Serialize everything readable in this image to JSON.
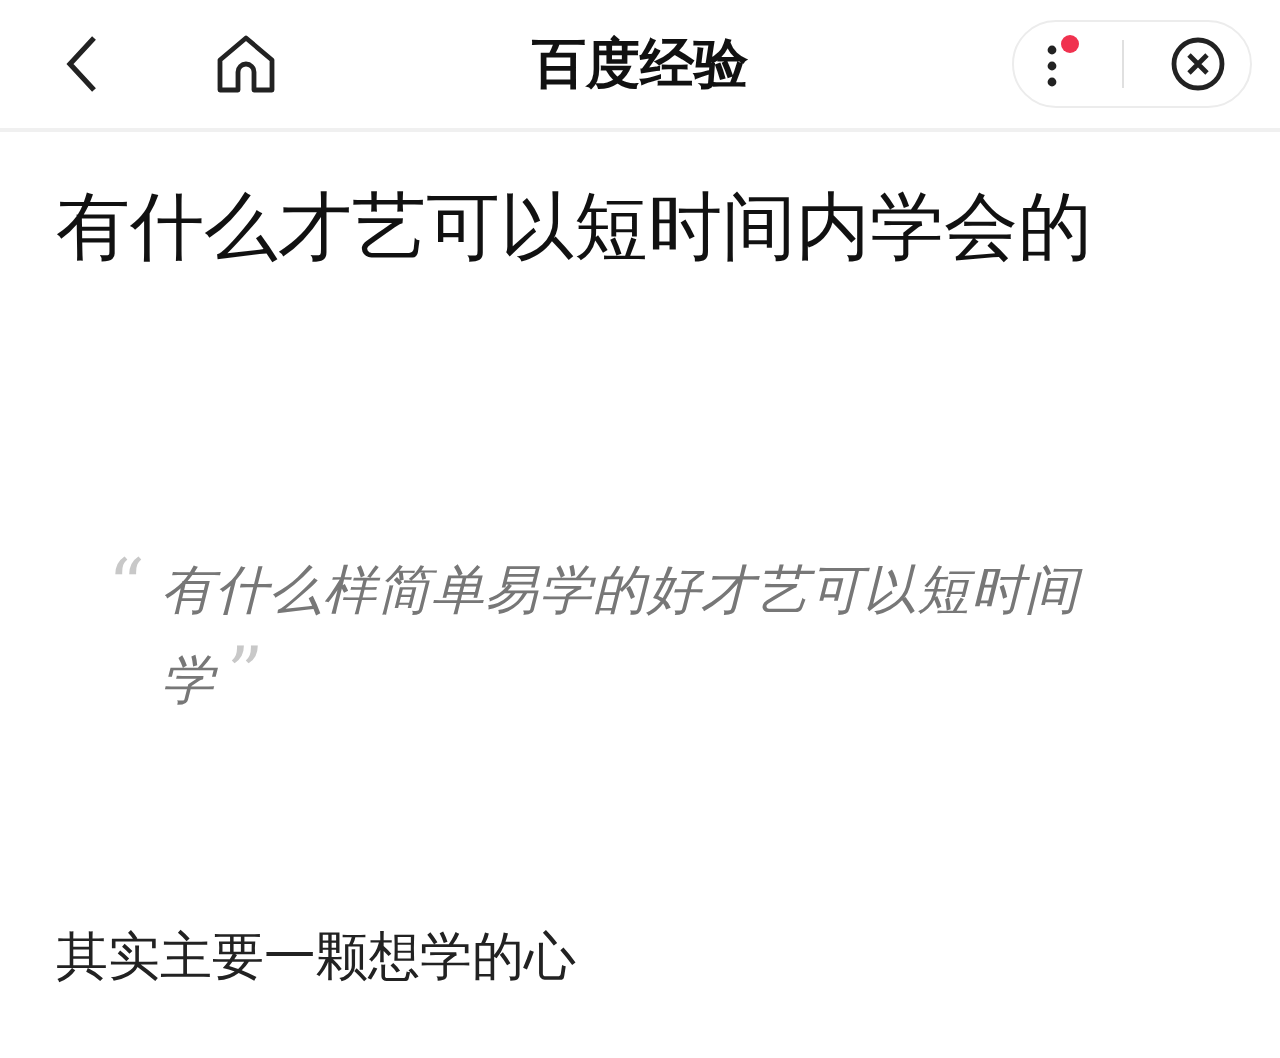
{
  "top_bar": {
    "title": "百度经验",
    "menu_has_notification": true
  },
  "article": {
    "title": "有什么才艺可以短时间内学会的",
    "quote": {
      "open_mark": "“",
      "text": "有什么样简单易学的好才艺可以短时间学",
      "close_mark": "”"
    },
    "paragraph": "其实主要一颗想学的心"
  }
}
